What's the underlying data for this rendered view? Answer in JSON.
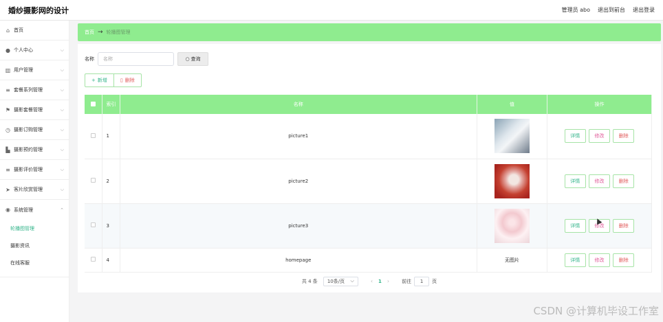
{
  "header": {
    "title": "婚纱摄影网的设计",
    "admin": "管理员 abo",
    "to_front": "退出到前台",
    "logout": "退出登录"
  },
  "sidebar": {
    "items": [
      {
        "label": "首页",
        "icon": "home-icon",
        "chevron": false
      },
      {
        "label": "个人中心",
        "icon": "user-icon",
        "chevron": true
      },
      {
        "label": "用户管理",
        "icon": "chart-icon",
        "chevron": true
      },
      {
        "label": "套餐系列管理",
        "icon": "list-icon",
        "chevron": true
      },
      {
        "label": "摄影套餐管理",
        "icon": "flag-icon",
        "chevron": true
      },
      {
        "label": "摄影订购管理",
        "icon": "clock-icon",
        "chevron": true
      },
      {
        "label": "摄影预约管理",
        "icon": "bar-icon",
        "chevron": true
      },
      {
        "label": "摄影评价管理",
        "icon": "list-icon",
        "chevron": true
      },
      {
        "label": "客片欣赏管理",
        "icon": "send-icon",
        "chevron": true
      },
      {
        "label": "系统管理",
        "icon": "compass-icon",
        "chevron": true
      }
    ],
    "sub_items": [
      "轮播图管理",
      "摄影资讯",
      "在线客服"
    ],
    "active_sub": 0
  },
  "breadcrumb": {
    "home": "首页",
    "sep": "→",
    "current": "轮播图管理"
  },
  "search": {
    "label": "名称",
    "placeholder": "名称",
    "button": "查询"
  },
  "actions": {
    "add": "新增",
    "delete": "删除"
  },
  "table": {
    "headers": {
      "index": "索引",
      "name": "名称",
      "image": "值",
      "ops": "操作"
    },
    "rows": [
      {
        "index": "1",
        "name": "picture1",
        "image": "thumb1",
        "image_text": ""
      },
      {
        "index": "2",
        "name": "picture2",
        "image": "thumb2",
        "image_text": ""
      },
      {
        "index": "3",
        "name": "picture3",
        "image": "thumb3",
        "image_text": ""
      },
      {
        "index": "4",
        "name": "homepage",
        "image": "",
        "image_text": "无图片"
      }
    ],
    "op_labels": {
      "detail": "详情",
      "edit": "修改",
      "delete": "删除"
    }
  },
  "pager": {
    "total": "共 4 条",
    "page_size": "10条/页",
    "current": "1",
    "goto_label": "前往",
    "goto_value": "1",
    "page_unit": "页"
  },
  "watermark": "CSDN @计算机毕设工作室",
  "colors": {
    "accent": "#8fec8f",
    "active": "#33b48a",
    "danger": "#e05b5b"
  }
}
